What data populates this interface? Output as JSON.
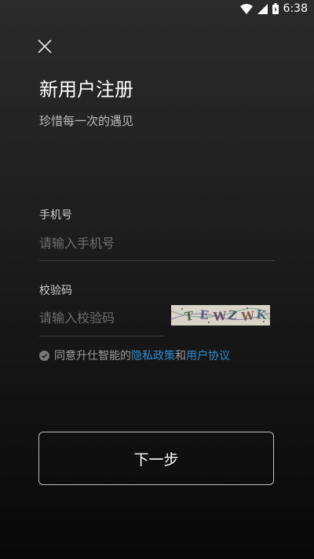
{
  "status_bar": {
    "time": "6:38",
    "icons": [
      "wifi-icon",
      "signal-icon",
      "battery-icon"
    ]
  },
  "header": {
    "close_icon": "close-icon",
    "title": "新用户注册",
    "subtitle": "珍惜每一次的遇见"
  },
  "form": {
    "phone": {
      "label": "手机号",
      "placeholder": "请输入手机号",
      "value": ""
    },
    "code": {
      "label": "校验码",
      "placeholder": "请输入校验码",
      "value": ""
    },
    "captcha": {
      "text": "TEWZWK",
      "chars": [
        "T",
        "E",
        "W",
        "Z",
        "W",
        "K"
      ]
    }
  },
  "agreement": {
    "prefix": "同意升仕智能的",
    "privacy_link": "隐私政策",
    "conjunction": "和",
    "terms_link": "用户协议"
  },
  "actions": {
    "next_label": "下一步"
  },
  "colors": {
    "link": "#2f8fd6",
    "background_top": "#2b2b2b",
    "background_bottom": "#080808"
  }
}
